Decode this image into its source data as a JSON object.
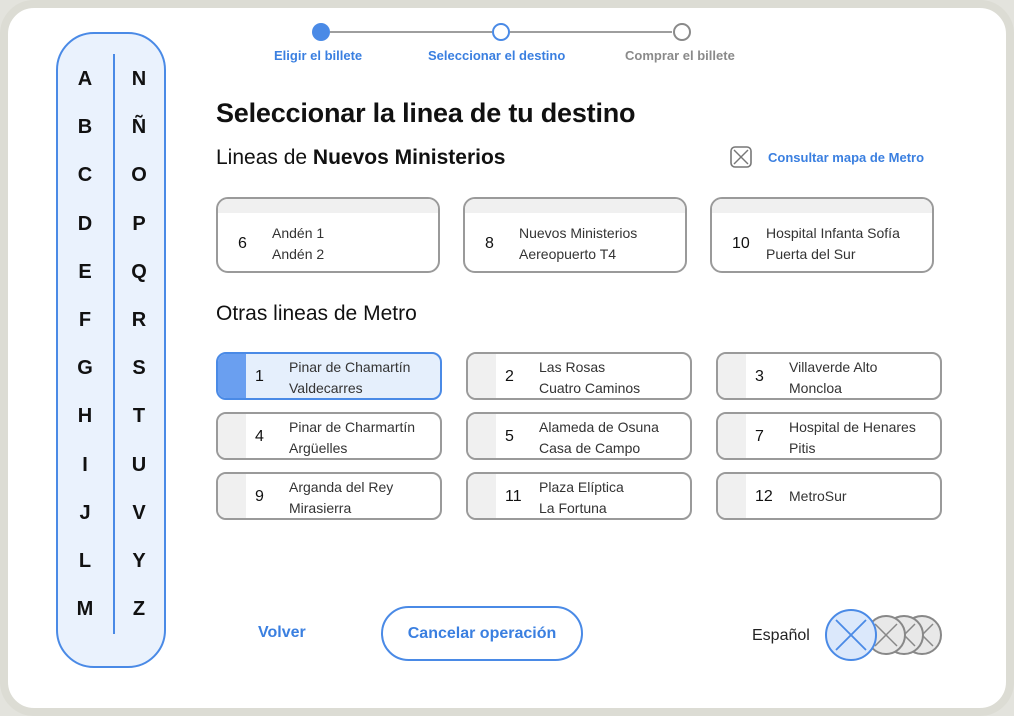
{
  "alphabet": {
    "left": [
      "A",
      "B",
      "C",
      "D",
      "E",
      "F",
      "G",
      "H",
      "I",
      "J",
      "L",
      "M"
    ],
    "right": [
      "N",
      "Ñ",
      "O",
      "P",
      "Q",
      "R",
      "S",
      "T",
      "U",
      "V",
      "Y",
      "Z"
    ]
  },
  "stepper": {
    "steps": [
      {
        "label": "Eligir el billete",
        "state": "done"
      },
      {
        "label": "Seleccionar el destino",
        "state": "current"
      },
      {
        "label": "Comprar el billete",
        "state": "pending"
      }
    ]
  },
  "title": "Seleccionar la linea de tu destino",
  "station_heading": {
    "prefix": "Lineas de ",
    "station": "Nuevos Ministerios"
  },
  "map_link": "Consultar mapa de Metro",
  "station_lines": [
    {
      "number": "6",
      "line1": "Andén 1",
      "line2": "Andén 2"
    },
    {
      "number": "8",
      "line1": "Nuevos Ministerios",
      "line2": "Aereopuerto T4"
    },
    {
      "number": "10",
      "line1": "Hospital Infanta Sofía",
      "line2": "Puerta del Sur"
    }
  ],
  "other_heading": "Otras lineas de Metro",
  "other_lines": [
    {
      "number": "1",
      "line1": "Pinar de Chamartín",
      "line2": "Valdecarres",
      "selected": true
    },
    {
      "number": "2",
      "line1": "Las Rosas",
      "line2": "Cuatro Caminos"
    },
    {
      "number": "3",
      "line1": "Villaverde Alto",
      "line2": "Moncloa"
    },
    {
      "number": "4",
      "line1": "Pinar de Charmartín",
      "line2": "Argüelles"
    },
    {
      "number": "5",
      "line1": "Alameda de Osuna",
      "line2": "Casa de Campo"
    },
    {
      "number": "7",
      "line1": "Hospital de Henares",
      "line2": "Pitis"
    },
    {
      "number": "9",
      "line1": "Arganda del Rey",
      "line2": "Mirasierra"
    },
    {
      "number": "11",
      "line1": "Plaza Elíptica",
      "line2": "La Fortuna"
    },
    {
      "number": "12",
      "line1": "MetroSur",
      "line2": ""
    }
  ],
  "footer": {
    "back_label": "Volver",
    "cancel_label": "Cancelar operación",
    "language_label": "Español"
  },
  "colors": {
    "accent": "#3a7fe0",
    "accent_bg": "#eaf2fd",
    "border": "#9a9a9a"
  }
}
